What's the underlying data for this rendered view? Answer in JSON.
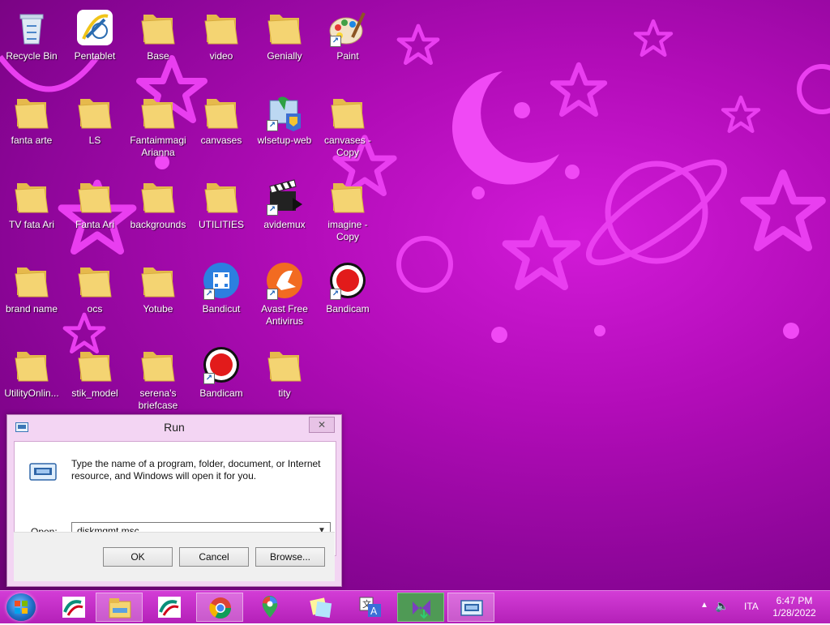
{
  "desktop_icons": [
    {
      "label": "Recycle Bin",
      "icon": "recycle-bin-icon"
    },
    {
      "label": "Pentablet",
      "icon": "pentablet-icon"
    },
    {
      "label": "Base",
      "icon": "folder-icon"
    },
    {
      "label": "video",
      "icon": "folder-icon"
    },
    {
      "label": "Genially",
      "icon": "folder-icon"
    },
    {
      "label": "Paint",
      "icon": "paint-icon"
    },
    {
      "label": "fanta arte",
      "icon": "folder-icon"
    },
    {
      "label": "LS",
      "icon": "folder-icon"
    },
    {
      "label": "Fantaimmagi Arianna",
      "icon": "folder-icon"
    },
    {
      "label": "canvases",
      "icon": "folder-icon"
    },
    {
      "label": "wlsetup-web",
      "icon": "installer-icon"
    },
    {
      "label": "canvases - Copy",
      "icon": "folder-icon"
    },
    {
      "label": "TV fata Ari",
      "icon": "folder-icon"
    },
    {
      "label": "Fanta Ari",
      "icon": "folder-icon"
    },
    {
      "label": "backgrounds",
      "icon": "folder-icon"
    },
    {
      "label": "UTILITIES",
      "icon": "folder-icon"
    },
    {
      "label": "avidemux",
      "icon": "clapperboard-icon"
    },
    {
      "label": "imagine - Copy",
      "icon": "folder-icon"
    },
    {
      "label": "brand name",
      "icon": "folder-icon"
    },
    {
      "label": "ocs",
      "icon": "folder-icon"
    },
    {
      "label": "Yotube",
      "icon": "folder-icon"
    },
    {
      "label": "Bandicut",
      "icon": "bandicut-icon"
    },
    {
      "label": "Avast Free Antivirus",
      "icon": "avast-icon"
    },
    {
      "label": "Bandicam",
      "icon": "bandicam-icon"
    },
    {
      "label": "UtilityOnlin...",
      "icon": "folder-icon"
    },
    {
      "label": "stik_model",
      "icon": "folder-icon"
    },
    {
      "label": "serena's briefcase",
      "icon": "folder-icon"
    },
    {
      "label": "Bandicam",
      "icon": "bandicam-icon"
    },
    {
      "label": "tity",
      "icon": "folder-icon"
    }
  ],
  "run_dialog": {
    "title": "Run",
    "close_label": "✕",
    "description": "Type the name of a program, folder, document, or Internet resource, and Windows will open it for you.",
    "open_label": "Open:",
    "open_value": "diskmgmt.msc",
    "ok_label": "OK",
    "cancel_label": "Cancel",
    "browse_label": "Browse..."
  },
  "taskbar": {
    "items": [
      {
        "name": "credit-agricole-icon",
        "active": false
      },
      {
        "name": "file-explorer-icon",
        "active": true
      },
      {
        "name": "credit-agricole-icon",
        "active": false
      },
      {
        "name": "chrome-icon",
        "active": true
      },
      {
        "name": "maps-pin-icon",
        "active": false
      },
      {
        "name": "sticky-notes-icon",
        "active": false
      },
      {
        "name": "translate-icon",
        "active": false
      },
      {
        "name": "visual-studio-installer-icon",
        "active": true
      },
      {
        "name": "run-window-icon",
        "active": true
      }
    ],
    "language": "ITA",
    "time": "6:47 PM",
    "date": "1/28/2022"
  },
  "colors": {
    "wallpaper": "#b20cb8",
    "taskbar": "#c22fc6",
    "folder": "#f4d472"
  }
}
